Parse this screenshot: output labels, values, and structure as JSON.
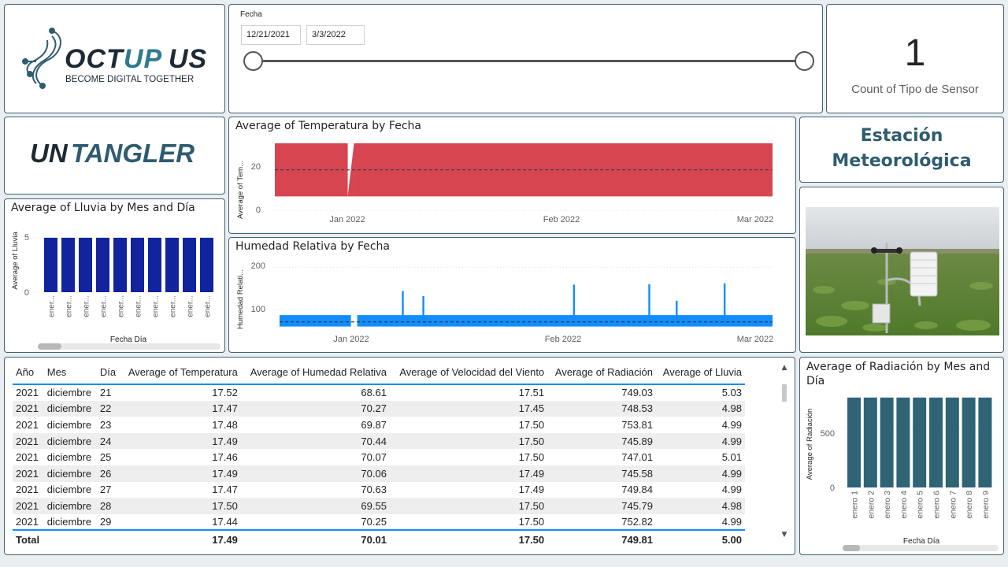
{
  "logo_octupus": {
    "brand": "OCTUPUS",
    "tagline": "BECOME DIGITAL TOGETHER"
  },
  "logo_untangler": {
    "brand": "UNTANGLER"
  },
  "date_slicer": {
    "label": "Fecha",
    "start": "12/21/2021",
    "end": "3/3/2022",
    "range_fraction": [
      0,
      1
    ]
  },
  "kpi": {
    "value": "1",
    "label": "Count of Tipo de Sensor"
  },
  "station": {
    "title_line1": "Estación",
    "title_line2": "Meteorológica"
  },
  "colors": {
    "accent": "#2e5c70",
    "temperature": "#d64550",
    "humidity": "#118dff",
    "rain": "#12239e",
    "radiation": "#2e6475",
    "table_accent": "#118dff"
  },
  "temp_chart": {
    "title": "Average of Temperatura by Fecha",
    "ylabel": "Average of Tem...",
    "yticks": [
      "20",
      "0"
    ],
    "xticks": [
      "Jan 2022",
      "Feb 2022",
      "Mar 2022"
    ]
  },
  "humidity_chart": {
    "title": "Humedad Relativa by Fecha",
    "ylabel": "Humedad Relati...",
    "yticks": [
      "200",
      "100"
    ],
    "xticks": [
      "Jan 2022",
      "Feb 2022",
      "Mar 2022"
    ]
  },
  "rain_chart": {
    "title": "Average of Lluvia by Mes and Día",
    "ylabel": "Average of Lluvia",
    "xlabel": "Fecha Día",
    "yticks": [
      "5",
      "0"
    ],
    "categories": [
      "ener...",
      "ener...",
      "ener...",
      "ener...",
      "ener...",
      "ener...",
      "ener...",
      "ener...",
      "ener...",
      "ener..."
    ]
  },
  "radiation_chart": {
    "title_line1": "Average of Radiación by Mes and",
    "title_line2": "Día",
    "ylabel": "Average of Radiación",
    "xlabel": "Fecha Día",
    "yticks": [
      "500",
      "0"
    ],
    "categories": [
      "enero 1",
      "enero 2",
      "enero 3",
      "enero 4",
      "enero 5",
      "enero 6",
      "enero 7",
      "enero 8",
      "enero 9"
    ]
  },
  "chart_data": [
    {
      "type": "area",
      "title": "Average of Temperatura by Fecha",
      "ylabel": "Average of Tem...",
      "x_range": [
        "2021-12-21",
        "2022-03-03"
      ],
      "ylim": [
        0,
        30
      ],
      "band_low": 6,
      "band_high": 29,
      "average_line": 17.5,
      "gap_date": "2022-01-01"
    },
    {
      "type": "line",
      "title": "Humedad Relativa by Fecha",
      "ylabel": "Humedad Relati...",
      "x_range": [
        "2021-12-21",
        "2022-03-03"
      ],
      "ylim": [
        50,
        210
      ],
      "band_low": 60,
      "band_high": 87,
      "average_line": 71,
      "spikes": [
        {
          "date": "2022-01-08",
          "value": 144
        },
        {
          "date": "2022-01-11",
          "value": 132
        },
        {
          "date": "2022-02-02",
          "value": 159
        },
        {
          "date": "2022-02-13",
          "value": 160
        },
        {
          "date": "2022-02-17",
          "value": 121
        },
        {
          "date": "2022-02-24",
          "value": 162
        }
      ]
    },
    {
      "type": "bar",
      "title": "Average of Lluvia by Mes and Día",
      "xlabel": "Fecha Día",
      "ylabel": "Average of Lluvia",
      "ylim": [
        0,
        5.5
      ],
      "values": [
        5,
        5,
        5,
        5,
        5,
        5,
        5,
        5,
        5,
        5
      ]
    },
    {
      "type": "bar",
      "title": "Average of Radiación by Mes and Día",
      "xlabel": "Fecha Día",
      "ylabel": "Average of Radiación",
      "ylim": [
        0,
        820
      ],
      "categories": [
        "enero 1",
        "enero 2",
        "enero 3",
        "enero 4",
        "enero 5",
        "enero 6",
        "enero 7",
        "enero 8",
        "enero 9"
      ],
      "values": [
        749,
        749,
        749,
        749,
        749,
        749,
        749,
        749,
        749
      ]
    }
  ],
  "table": {
    "headers": [
      "Año",
      "Mes",
      "Día",
      "Average of Temperatura",
      "Average of Humedad Relativa",
      "Average of Velocidad del Viento",
      "Average of Radiación",
      "Average of Lluvia"
    ],
    "rows": [
      [
        "2021",
        "diciembre",
        "21",
        "17.52",
        "68.61",
        "17.51",
        "749.03",
        "5.03"
      ],
      [
        "2021",
        "diciembre",
        "22",
        "17.47",
        "70.27",
        "17.45",
        "748.53",
        "4.98"
      ],
      [
        "2021",
        "diciembre",
        "23",
        "17.48",
        "69.87",
        "17.50",
        "753.81",
        "4.99"
      ],
      [
        "2021",
        "diciembre",
        "24",
        "17.49",
        "70.44",
        "17.50",
        "745.89",
        "4.99"
      ],
      [
        "2021",
        "diciembre",
        "25",
        "17.46",
        "70.07",
        "17.50",
        "747.01",
        "5.01"
      ],
      [
        "2021",
        "diciembre",
        "26",
        "17.49",
        "70.06",
        "17.49",
        "745.58",
        "4.99"
      ],
      [
        "2021",
        "diciembre",
        "27",
        "17.47",
        "70.63",
        "17.49",
        "749.84",
        "4.99"
      ],
      [
        "2021",
        "diciembre",
        "28",
        "17.50",
        "69.55",
        "17.50",
        "745.79",
        "4.98"
      ],
      [
        "2021",
        "diciembre",
        "29",
        "17.44",
        "70.25",
        "17.50",
        "752.82",
        "4.99"
      ]
    ],
    "total": [
      "Total",
      "",
      "",
      "17.49",
      "70.01",
      "17.50",
      "749.81",
      "5.00"
    ]
  }
}
